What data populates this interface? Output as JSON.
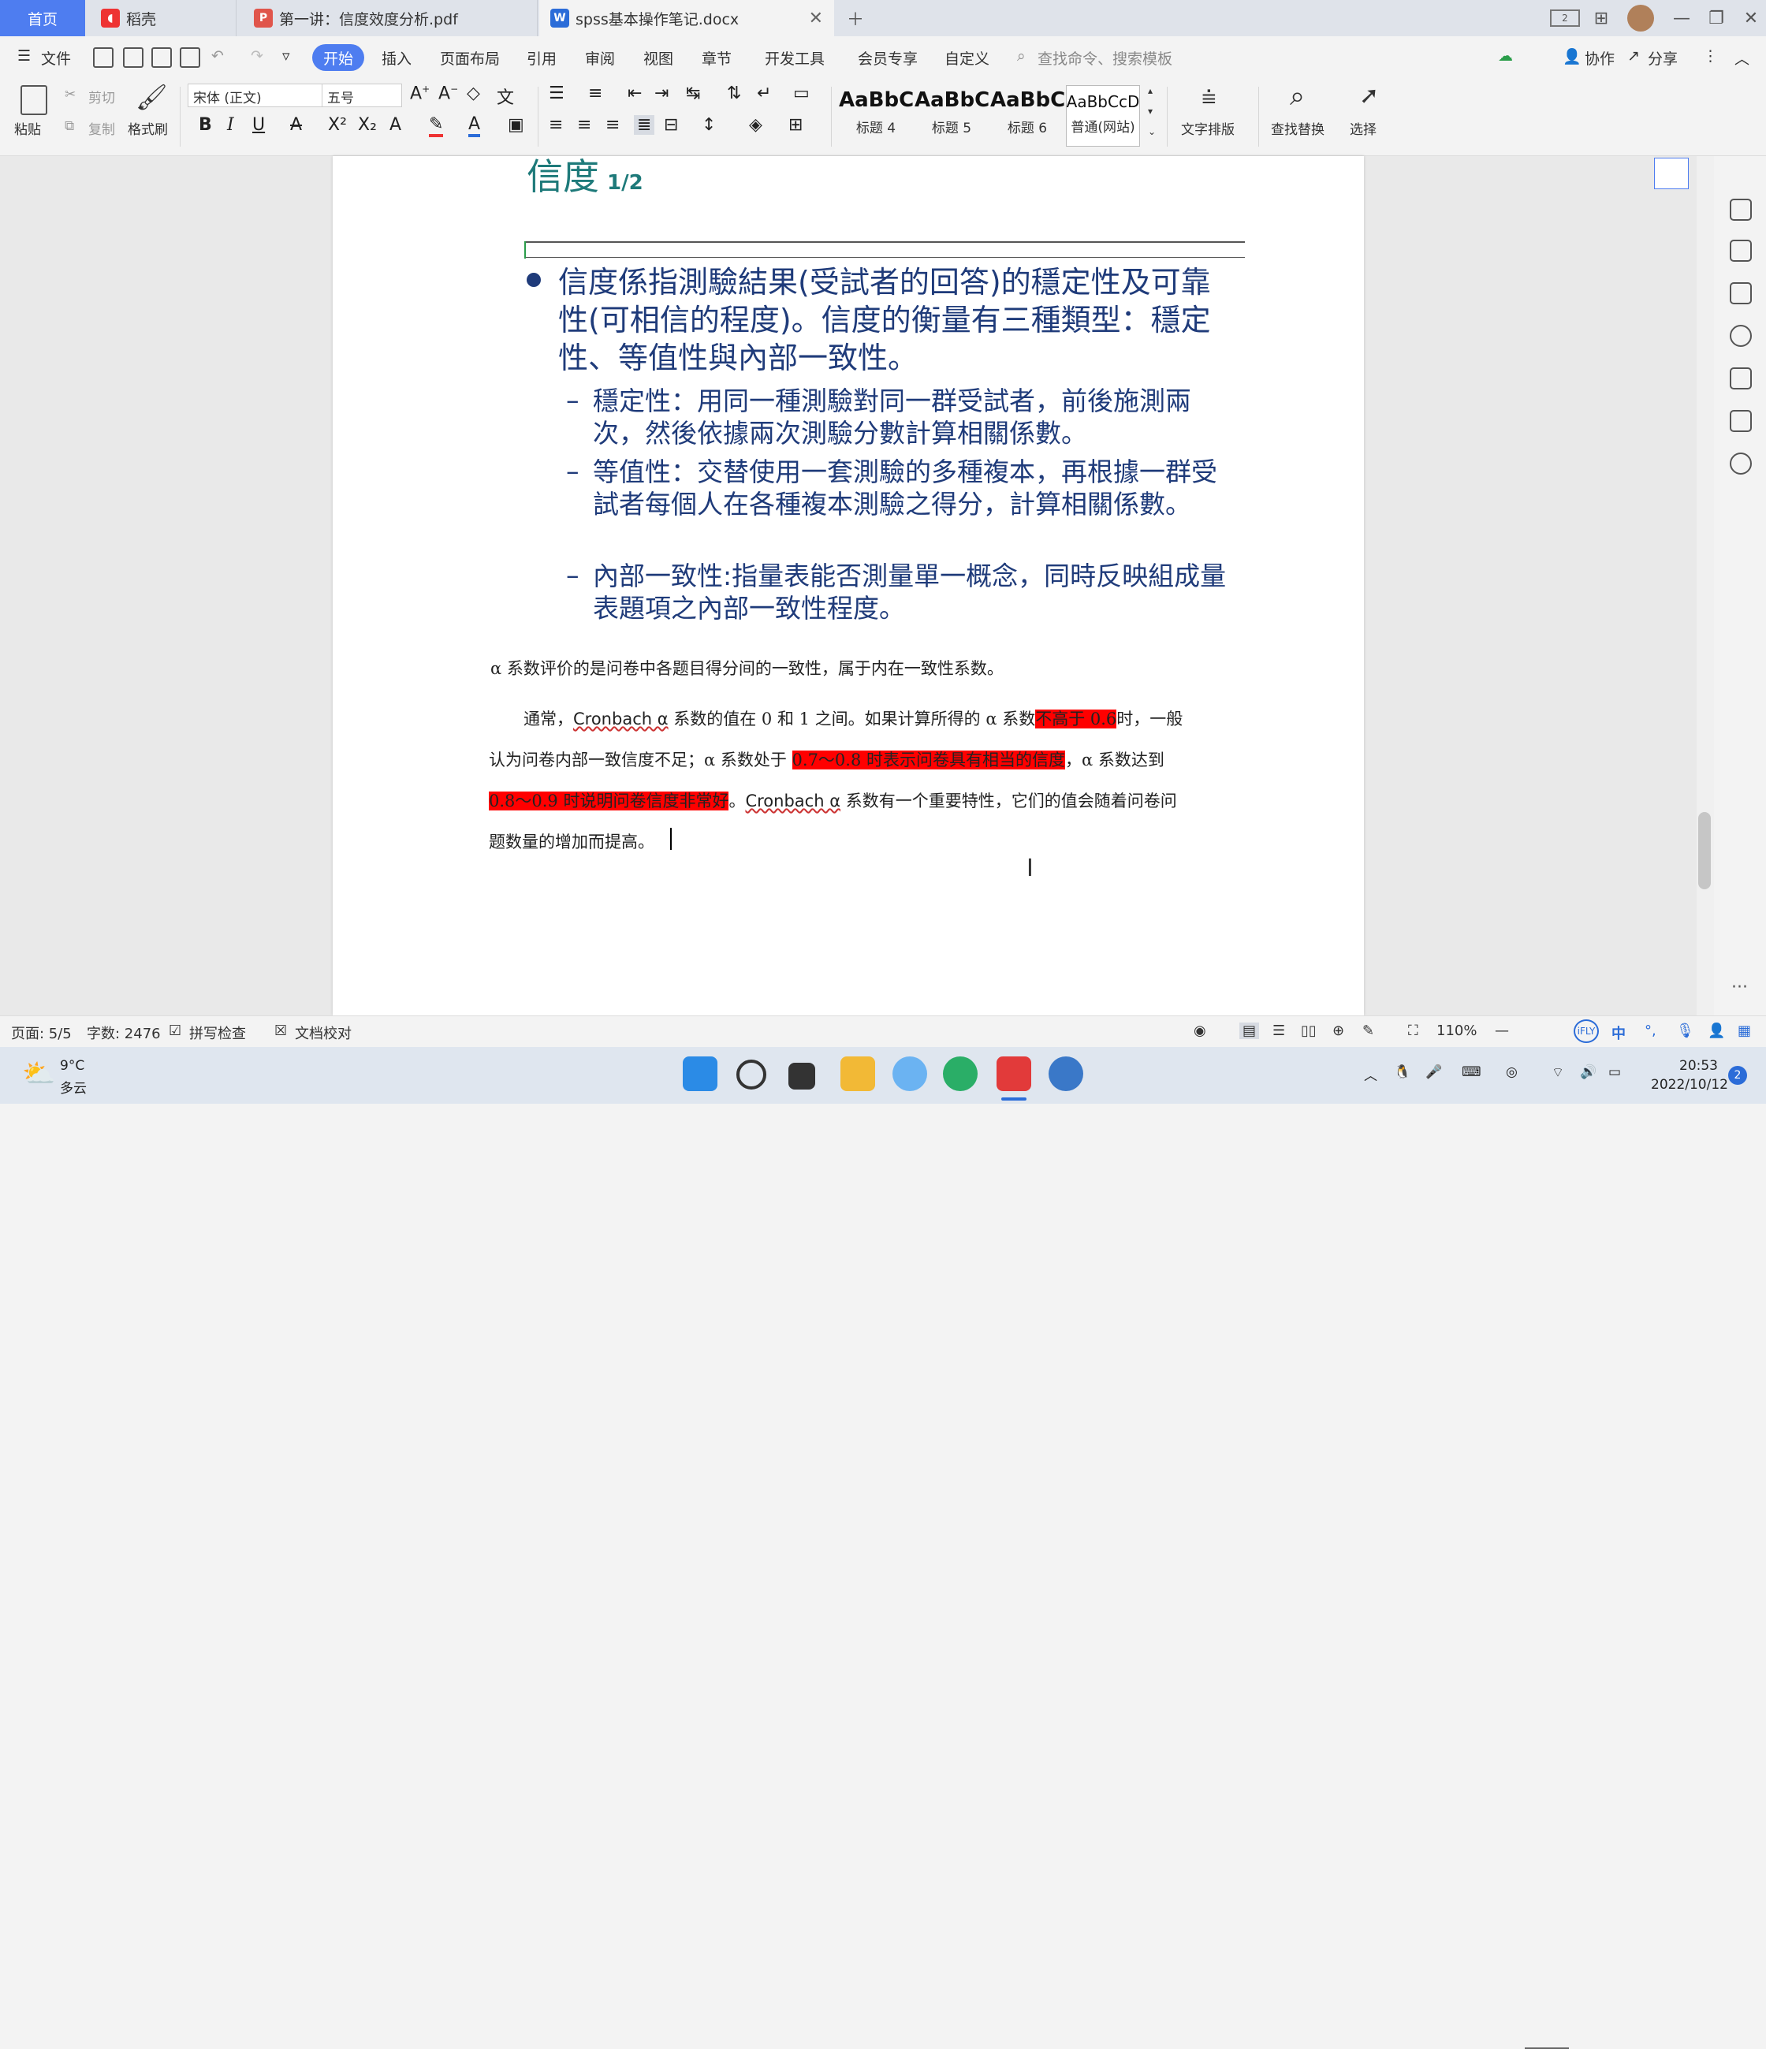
{
  "tabs": {
    "home": "首页",
    "daoke": "稻壳",
    "pdf": "第一讲：信度效度分析.pdf",
    "doc": "spss基本操作笔记.docx"
  },
  "menu": {
    "file": "文件",
    "items": [
      "开始",
      "插入",
      "页面布局",
      "引用",
      "审阅",
      "视图",
      "章节",
      "开发工具",
      "会员专享",
      "自定义"
    ],
    "search_placeholder": "查找命令、搜索模板",
    "collab": "协作",
    "share": "分享"
  },
  "ribbon": {
    "paste": "粘贴",
    "cut": "剪切",
    "copy": "复制",
    "format_painter": "格式刷",
    "font_name": "宋体 (正文)",
    "font_size": "五号",
    "styles": [
      {
        "sample": "AaBbC",
        "label": "标题 4"
      },
      {
        "sample": "AaBbCc",
        "label": "标题 5"
      },
      {
        "sample": "AaBbCc",
        "label": "标题 6"
      },
      {
        "sample": "AaBbCcD",
        "label": "普通(网站)"
      }
    ],
    "text_layout": "文字排版",
    "find_replace": "查找替换",
    "select": "选择"
  },
  "document": {
    "slide_title": "信度",
    "slide_page": "1/2",
    "bullet_main": "信度係指測驗結果(受試者的回答)的穩定性及可靠性(可相信的程度)。信度的衡量有三種類型：穩定性、等值性與內部一致性。",
    "sub_items": [
      "穩定性：用同一種測驗對同一群受試者，前後施測兩次，然後依據兩次測驗分數計算相關係數。",
      "等值性：交替使用一套測驗的多種複本，再根據一群受試者每個人在各種複本測驗之得分，計算相關係數。",
      "內部一致性:指量表能否測量單一概念，同時反映組成量表題項之內部一致性程度。"
    ],
    "alpha_line": "α 系数评价的是问卷中各题目得分间的一致性，属于内在一致性系数。",
    "p1_a": "通常，",
    "p1_cronbach": "Cronbach α",
    "p1_b": " 系数的值在 0 和 1 之间。如果计算所得的 α 系数",
    "p1_hl": "不高于 0.6",
    "p1_c": "时，一般",
    "p2_a": "认为问卷内部一致信度不足；α 系数处于 ",
    "p2_hl": "0.7～0.8 时表示问卷具有相当的信度",
    "p2_b": "，α 系数达到",
    "p3_hl": "0.8～0.9 时说明问卷信度非常好",
    "p3_a": "。",
    "p3_cronbach": "Cronbach α",
    "p3_b": " 系数有一个重要特性，它们的值会随着问卷问",
    "p4": "题数量的增加而提高。"
  },
  "status": {
    "page": "页面: 5/5",
    "words": "字数: 2476",
    "spell": "拼写检查",
    "proof": "文档校对",
    "zoom": "110%"
  },
  "taskbar": {
    "temp": "9°C",
    "weather": "多云",
    "time": "20:53",
    "date": "2022/10/12",
    "ime": "中",
    "notif_count": "2"
  },
  "colors": {
    "accent": "#4e7df0",
    "highlight": "#ff0000",
    "slide_text": "#1f3b7a",
    "title_teal": "#1e7a7a"
  }
}
